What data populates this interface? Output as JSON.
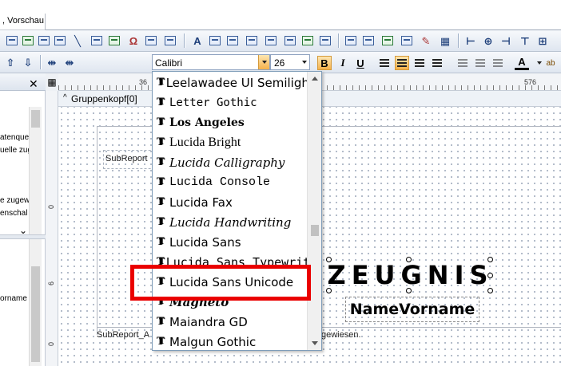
{
  "tabs": {
    "preview": ", Vorschau"
  },
  "format_toolbar": {
    "font_family": "Calibri",
    "font_size": "26",
    "bold": "B",
    "italic": "I",
    "underline": "U",
    "text_color": "A"
  },
  "left_panel": {
    "items": [
      "atenque",
      "uelle zug",
      "e zugew",
      "enschal",
      "orname"
    ]
  },
  "ruler": {
    "h_labels": [
      "36",
      "576"
    ],
    "v_labels": [
      "0",
      "6",
      "0",
      "6"
    ]
  },
  "band": {
    "header_label": "Gruppenkopf[0]"
  },
  "report": {
    "subreport1": "SubReport",
    "subreport2": "SubReport_A",
    "subreport2_tail": "gewiesen.",
    "title": "ZEUGNIS",
    "name_field": "NameVorname"
  },
  "font_dropdown": {
    "items": [
      {
        "name": "Leelawadee UI Semilight",
        "style": "normal"
      },
      {
        "name": "Letter Gothic",
        "style": "mono"
      },
      {
        "name": "Los Angeles",
        "style": "bold"
      },
      {
        "name": "Lucida Bright",
        "style": "serif"
      },
      {
        "name": "Lucida Calligraphy",
        "style": "script"
      },
      {
        "name": "Lucida Console",
        "style": "mono"
      },
      {
        "name": "Lucida Fax",
        "style": "serif"
      },
      {
        "name": "Lucida Handwriting",
        "style": "script"
      },
      {
        "name": "Lucida Sans",
        "style": "normal"
      },
      {
        "name": "Lucida Sans Typewriter",
        "style": "mono"
      },
      {
        "name": "Lucida Sans Unicode",
        "style": "normal"
      },
      {
        "name": "Magneto",
        "style": "bold"
      },
      {
        "name": "Maiandra GD",
        "style": "normal"
      },
      {
        "name": "Malgun Gothic",
        "style": "normal"
      }
    ],
    "highlighted": "Lucida Sans Unicode"
  },
  "colors": {
    "highlight": "#ea0000",
    "accent": "#f5b14a"
  }
}
